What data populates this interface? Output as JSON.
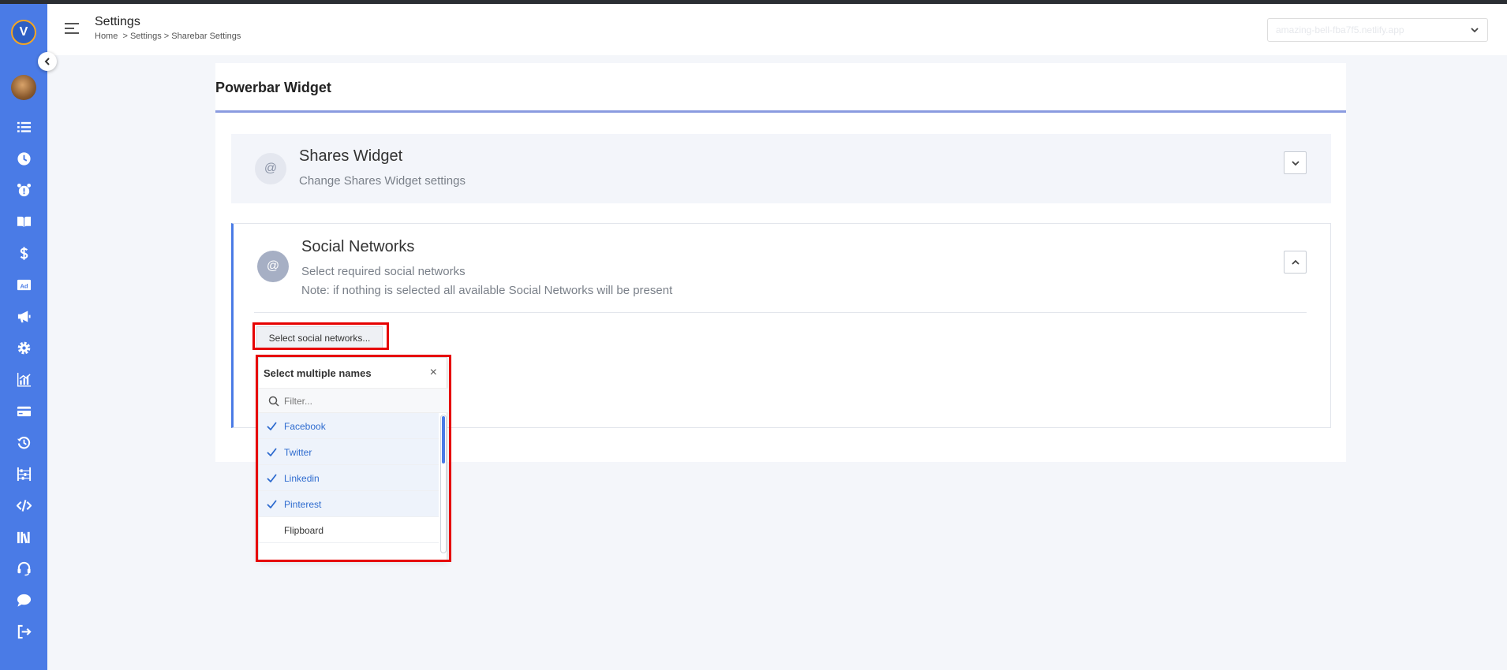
{
  "app": {
    "logo_letter": "V",
    "accent": "#4a7be6"
  },
  "sidebar": {
    "items": [
      {
        "icon": "list-icon"
      },
      {
        "icon": "clock-icon"
      },
      {
        "icon": "alarm-icon"
      },
      {
        "icon": "book-icon"
      },
      {
        "icon": "dollar-icon"
      },
      {
        "icon": "ad-icon"
      },
      {
        "icon": "megaphone-icon"
      },
      {
        "icon": "gear-icon"
      },
      {
        "icon": "chart-icon"
      },
      {
        "icon": "card-icon"
      },
      {
        "icon": "history-icon"
      },
      {
        "icon": "abacus-icon"
      },
      {
        "icon": "code-icon"
      },
      {
        "icon": "library-icon"
      },
      {
        "icon": "headset-icon"
      },
      {
        "icon": "chat-icon"
      },
      {
        "icon": "logout-icon"
      }
    ]
  },
  "header": {
    "title": "Settings",
    "breadcrumb": [
      "Home",
      "Settings",
      "Sharebar Settings"
    ],
    "breadcrumb_sep": ">",
    "site_select_value": "amazing-bell-fba7f5.netlify.app"
  },
  "main": {
    "widget_title": "Powerbar Widget",
    "shares_panel": {
      "icon_glyph": "@",
      "heading": "Shares Widget",
      "subtitle": "Change Shares Widget settings"
    },
    "social_panel": {
      "icon_glyph": "@",
      "heading": "Social Networks",
      "subtitle": "Select required social networks",
      "note": "Note: if nothing is selected all available Social Networks will be present",
      "select_button_label": "Select social networks..."
    },
    "dropdown": {
      "title": "Select multiple names",
      "close_glyph": "×",
      "filter_placeholder": "Filter...",
      "items": [
        {
          "label": "Facebook",
          "selected": true
        },
        {
          "label": "Twitter",
          "selected": true
        },
        {
          "label": "Linkedin",
          "selected": true
        },
        {
          "label": "Pinterest",
          "selected": true
        },
        {
          "label": "Flipboard",
          "selected": false
        }
      ]
    }
  }
}
